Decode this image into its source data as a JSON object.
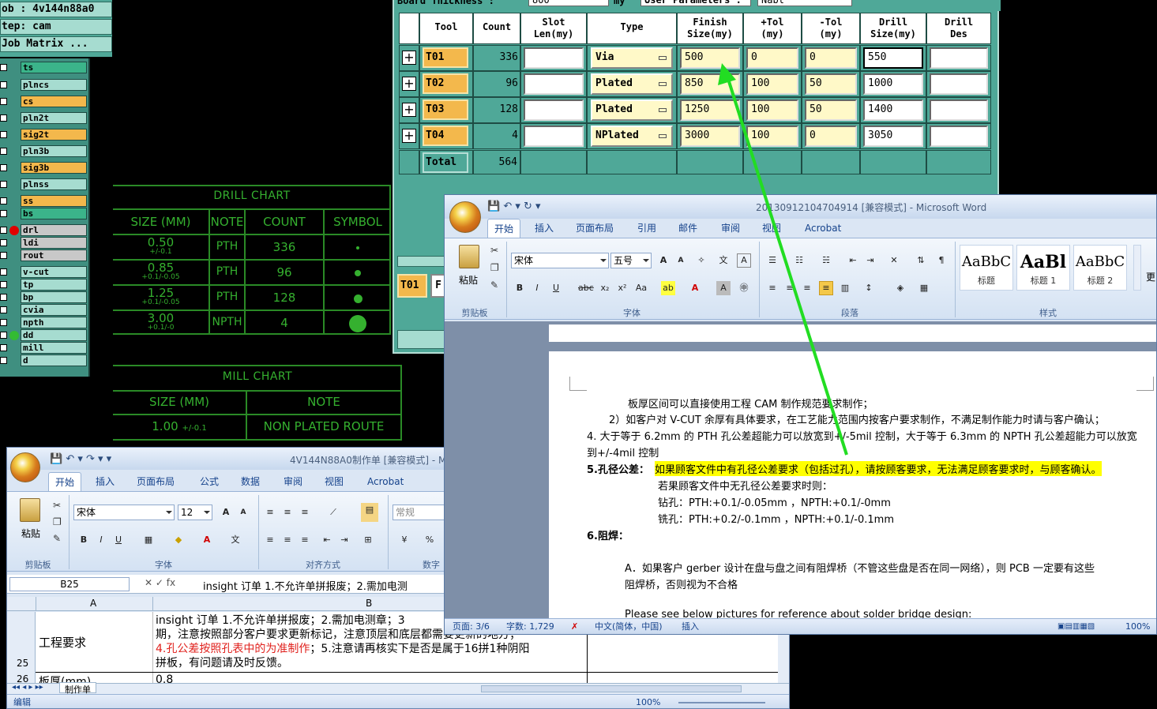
{
  "cam": {
    "job_label": "ob : 4v144n88a0",
    "step_label": "tep: cam",
    "matrix_button": "Job Matrix ...",
    "layers": [
      {
        "name": "ts",
        "color": "#3bb48a"
      },
      {
        "name": "plncs",
        "color": "#a6dcd0"
      },
      {
        "name": "cs",
        "color": "#f3b84c"
      },
      {
        "name": "pln2t",
        "color": "#a6dcd0"
      },
      {
        "name": "sig2t",
        "color": "#f3b84c"
      },
      {
        "name": "pln3b",
        "color": "#a6dcd0"
      },
      {
        "name": "sig3b",
        "color": "#f3b84c"
      },
      {
        "name": "plnss",
        "color": "#a6dcd0"
      },
      {
        "name": "ss",
        "color": "#f3b84c"
      },
      {
        "name": "bs",
        "color": "#3bb48a"
      },
      {
        "name": "drl",
        "color": "#c8c8c8",
        "dot": "#e00000"
      },
      {
        "name": "ldi",
        "color": "#c8c8c8"
      },
      {
        "name": "rout",
        "color": "#c8c8c8"
      },
      {
        "name": "v-cut",
        "color": "#a6dcd0"
      },
      {
        "name": "tp",
        "color": "#a6dcd0"
      },
      {
        "name": "bp",
        "color": "#a6dcd0"
      },
      {
        "name": "cvia",
        "color": "#a6dcd0"
      },
      {
        "name": "npth",
        "color": "#a6dcd0"
      },
      {
        "name": "dd",
        "color": "#a6dcd0",
        "dot": "#33bb33"
      },
      {
        "name": "mill",
        "color": "#a6dcd0"
      },
      {
        "name": "d",
        "color": "#a6dcd0"
      }
    ]
  },
  "drill_chart": {
    "title": "DRILL CHART",
    "headers": [
      "SIZE (MM)",
      "NOTE",
      "COUNT",
      "SYMBOL"
    ],
    "rows": [
      {
        "size": "0.50",
        "tol": "+/-0.1",
        "note": "PTH",
        "count": "336",
        "symbol": 0.2
      },
      {
        "size": "0.85",
        "tol": "+0.1/-0.05",
        "note": "PTH",
        "count": "96",
        "symbol": 0.35
      },
      {
        "size": "1.25",
        "tol": "+0.1/-0.05",
        "note": "PTH",
        "count": "128",
        "symbol": 0.5
      },
      {
        "size": "3.00",
        "tol": "+0.1/-0",
        "note": "NPTH",
        "count": "4",
        "symbol": 1.0
      }
    ]
  },
  "mill_chart": {
    "title": "MILL CHART",
    "headers": [
      "SIZE (MM)",
      "NOTE"
    ],
    "row": {
      "size": "1.00",
      "tol": "+/-0.1",
      "note": "NON PLATED ROUTE"
    }
  },
  "tool_table": {
    "top_labels": [
      "Board Thickness :",
      "800",
      "my",
      "User Parameters :",
      "Nabl"
    ],
    "headers": [
      "Tool",
      "Count",
      "Slot\nLen(my)",
      "Type",
      "Finish\nSize(my)",
      "+Tol\n(my)",
      "-Tol\n(my)",
      "Drill\nSize(my)",
      "Drill\nDes"
    ],
    "rows": [
      {
        "tool": "T01",
        "count": "336",
        "slot": "",
        "type": "Via",
        "finish": "500",
        "ptol": "0",
        "ntol": "0",
        "drill": "550",
        "des": ""
      },
      {
        "tool": "T02",
        "count": "96",
        "slot": "",
        "type": "Plated",
        "finish": "850",
        "ptol": "100",
        "ntol": "50",
        "drill": "1000",
        "des": ""
      },
      {
        "tool": "T03",
        "count": "128",
        "slot": "",
        "type": "Plated",
        "finish": "1250",
        "ptol": "100",
        "ntol": "50",
        "drill": "1400",
        "des": ""
      },
      {
        "tool": "T04",
        "count": "4",
        "slot": "",
        "type": "NPlated",
        "finish": "3000",
        "ptol": "100",
        "ntol": "0",
        "drill": "3050",
        "des": ""
      }
    ],
    "total_label": "Total",
    "total_count": "564",
    "bottom_tool": "T01",
    "bottom_btn": "F"
  },
  "word": {
    "title": "20130912104704914 [兼容模式] - Microsoft Word",
    "tabs": [
      "开始",
      "插入",
      "页面布局",
      "引用",
      "邮件",
      "审阅",
      "视图",
      "Acrobat"
    ],
    "font_name": "宋体",
    "font_size": "五号",
    "paste_label": "粘贴",
    "groups": [
      "剪贴板",
      "字体",
      "段落",
      "样式"
    ],
    "styles": [
      {
        "sample": "AaBbC",
        "name": "标题"
      },
      {
        "sample": "AaBl",
        "name": "标题 1"
      },
      {
        "sample": "AaBbC",
        "name": "标题 2"
      }
    ],
    "more_label": "更",
    "lines": [
      "板厚区间可以直接使用工程 CAM 制作规范要求制作；",
      "2）如客户对 V-CUT 余厚有具体要求，在工艺能力范围内按客户要求制作，不满足制作能力时请与客户确认；",
      "4. 大于等于 6.2mm 的 PTH 孔公差超能力可以放宽到+/-5mil 控制，大于等于 6.3mm 的 NPTH 孔公差超能力可以放宽",
      "到+/-4mil 控制",
      "5.孔径公差：",
      "如果顾客文件中有孔径公差要求（包括过孔），请按顾客要求，无法满足顾客要求时，与顾客确认。",
      "若果顾客文件中无孔径公差要求时则：",
      "钻孔：PTH:+0.1/-0.05mm ，NPTH:+0.1/-0mm",
      "铣孔：PTH:+0.2/-0.1mm ，NPTH:+0.1/-0.1mm",
      "6.阻焊：",
      "A．如果客户 gerber 设计在盘与盘之间有阻焊桥（不管这些盘是否在同一网络），则 PCB 一定要有这些",
      "阻焊桥，否则视为不合格",
      "Please see below pictures for reference about solder bridge design:"
    ],
    "status": {
      "page": "页面: 3/6",
      "words": "字数: 1,729",
      "lang": "中文(简体，中国)",
      "mode": "插入",
      "zoom": "100%"
    }
  },
  "excel": {
    "title": "4V144N88A0制作单 [兼容模式] - M",
    "tabs": [
      "开始",
      "插入",
      "页面布局",
      "公式",
      "数据",
      "审阅",
      "视图",
      "Acrobat"
    ],
    "font_name": "宋体",
    "font_size": "12",
    "paste_label": "粘贴",
    "groups": [
      "剪贴板",
      "字体",
      "对齐方式",
      "数字"
    ],
    "number_format": "常规",
    "name_box": "B25",
    "formula": "insight 订单 1.不允许单拼报废；2.需加电测",
    "col_a": "A",
    "col_b": "B",
    "row25": "25",
    "row26": "26",
    "cell_a25": "工程要求",
    "cell_b25_lines": [
      "insight 订单 1.不允许单拼报废；2.需加电测章；3",
      "期，注意按照部分客户要求更新标记，注意顶层和底层都需要更新的地方；",
      "孔公差按照孔表中的为准制作",
      "；5.注意请再核实下是否是属于16拼1种阴阳",
      "拼板，有问题请及时反馈。"
    ],
    "cell_b25_prefix": "4.",
    "cell_a26": "板厚(mm)",
    "cell_b26": "0.8",
    "sheet_tab": "制作单",
    "status_left": "编辑",
    "zoom": "100%",
    "accent_red": "#e0201c"
  },
  "annotation_arrow_color": "#22dd22"
}
